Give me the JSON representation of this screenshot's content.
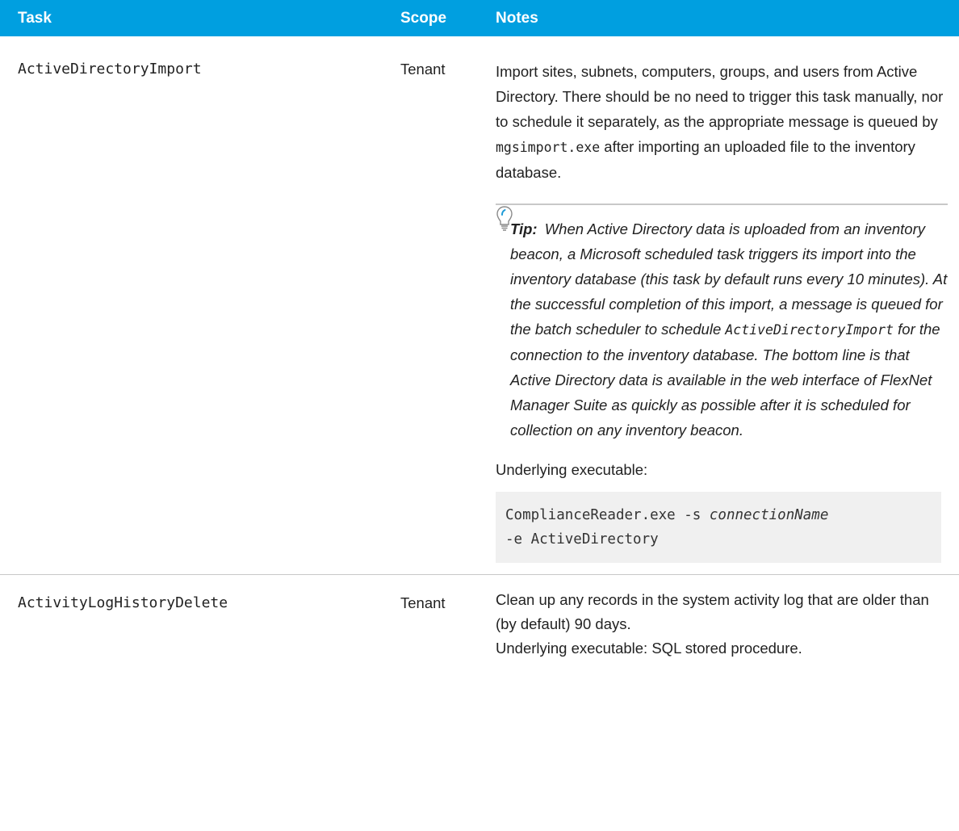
{
  "table": {
    "headers": {
      "task": "Task",
      "scope": "Scope",
      "notes": "Notes"
    },
    "rows": [
      {
        "task": "ActiveDirectoryImport",
        "scope": "Tenant",
        "notes": {
          "p1_a": "Import sites, subnets, computers, groups, and users from Active Directory. There should be no need to trigger this task manually, nor to schedule it separately, as the appropriate message is queued by ",
          "p1_code": "mgsimport.exe",
          "p1_b": " after importing an uploaded file to the inventory database.",
          "tip_label": "Tip:",
          "tip_a": " When Active Directory data is uploaded from an inventory beacon, a Microsoft scheduled task triggers its import into the inventory database (this task by default runs every 10 minutes). At the successful completion of this import, a message is queued for the batch scheduler to schedule ",
          "tip_code": "ActiveDirectoryImport",
          "tip_b": " for the connection to the inventory database. The bottom line is that Active Directory data is available in the web interface of FlexNet Manager Suite as quickly as possible after it is scheduled for collection on any inventory beacon.",
          "underlying_label": "Underlying executable:",
          "code_line1_a": "ComplianceReader.exe -s ",
          "code_line1_var": "connectionName",
          "code_line2": "-e ActiveDirectory"
        }
      },
      {
        "task": "ActivityLogHistoryDelete",
        "scope": "Tenant",
        "notes": {
          "p1": "Clean up any records in the system activity log that are older than (by default) 90 days.",
          "p2": "Underlying executable: SQL stored procedure."
        }
      }
    ]
  },
  "icons": {
    "tip": "lightbulb-icon"
  },
  "colors": {
    "header_bg": "#009fe0",
    "header_text": "#ffffff",
    "code_bg": "#f0f0f0",
    "rule": "#c8c8c8"
  }
}
